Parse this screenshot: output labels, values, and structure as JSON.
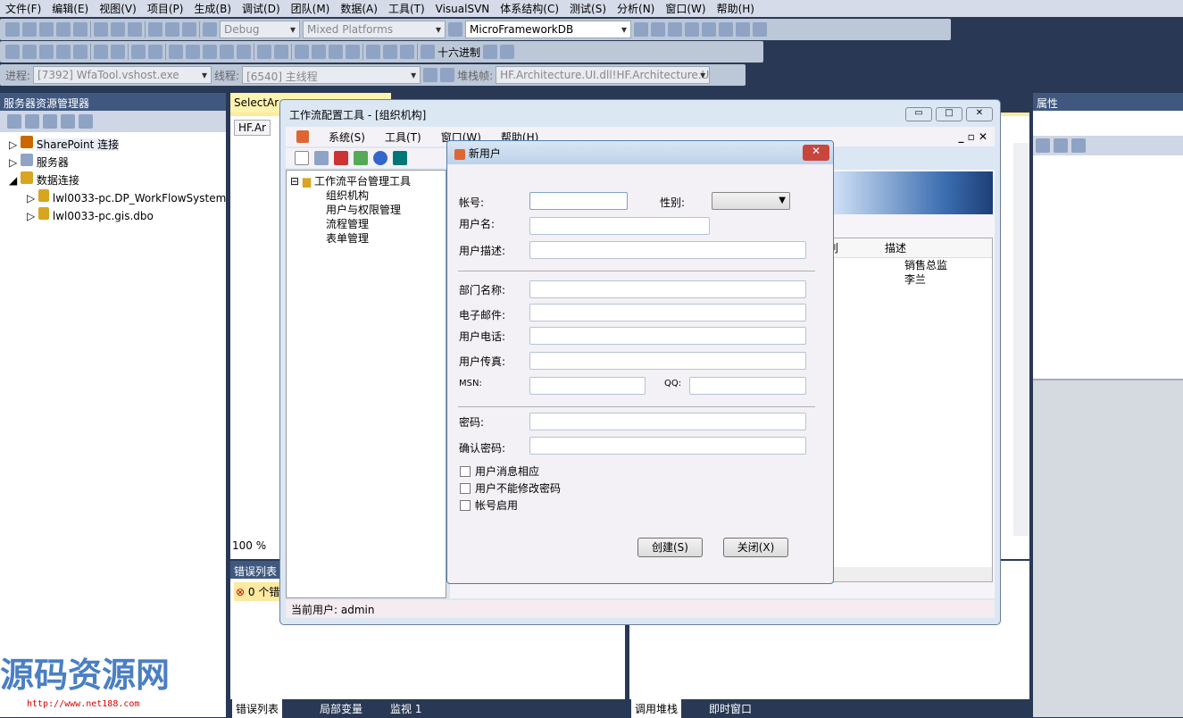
{
  "menu": [
    "文件(F)",
    "编辑(E)",
    "视图(V)",
    "项目(P)",
    "生成(B)",
    "调试(D)",
    "团队(M)",
    "数据(A)",
    "工具(T)",
    "VisualSVN",
    "体系结构(C)",
    "测试(S)",
    "分析(N)",
    "窗口(W)",
    "帮助(H)"
  ],
  "toolbar": {
    "config": "Debug",
    "platform": "Mixed Platforms",
    "db": "MicroFrameworkDB",
    "hex": "十六进制",
    "process_label": "进程:",
    "process": "[7392] WfaTool.vshost.exe",
    "thread_label": "线程:",
    "thread": "[6540] 主线程",
    "stack_label": "堆栈帧:",
    "stack": "HF.Architecture.UI.dll!HF.Architecture.U"
  },
  "server_explorer": {
    "title": "服务器资源管理器",
    "items": [
      "SharePoint 连接",
      "服务器",
      "数据连接",
      "lwl0033-pc.DP_WorkFlowSystem",
      "lwl0033-pc.gis.dbo"
    ]
  },
  "doc": {
    "tab": "SelectAr",
    "sub": "HF.Ar",
    "zoom": "100 %"
  },
  "properties": {
    "title": "属性"
  },
  "workflow": {
    "title": "工作流配置工具 - [组织机构]",
    "menu": [
      "系统(S)",
      "工具(T)",
      "窗口(W)",
      "帮助(H)"
    ],
    "tree": [
      "工作流平台管理工具",
      "组织机构",
      "用户与权限管理",
      "流程管理",
      "表单管理"
    ],
    "grid_headers": [
      "别",
      "描述"
    ],
    "grid_rows": [
      "销售总监",
      "李兰"
    ],
    "status": "当前用户: admin"
  },
  "dialog": {
    "title": "新用户",
    "fields": {
      "account": "帐号:",
      "gender": "性别:",
      "username": "用户名:",
      "desc": "用户描述:",
      "dept": "部门名称:",
      "email": "电子邮件:",
      "phone": "用户电话:",
      "fax": "用户传真:",
      "msn": "MSN:",
      "qq": "QQ:",
      "pwd": "密码:",
      "pwd2": "确认密码:"
    },
    "checks": [
      "用户消息相应",
      "用户不能修改密码",
      "帐号启用"
    ],
    "create": "创建(S)",
    "close": "关闭(X)"
  },
  "errors": {
    "title": "错误列表",
    "count": "0 个错"
  },
  "bottom_tabs_left": [
    "错误列表",
    "局部变量",
    "监视 1"
  ],
  "bottom_tabs_right": [
    "调用堆栈",
    "即时窗口"
  ],
  "watermark": {
    "text": "源码资源网",
    "url": "http://www.net188.com"
  }
}
